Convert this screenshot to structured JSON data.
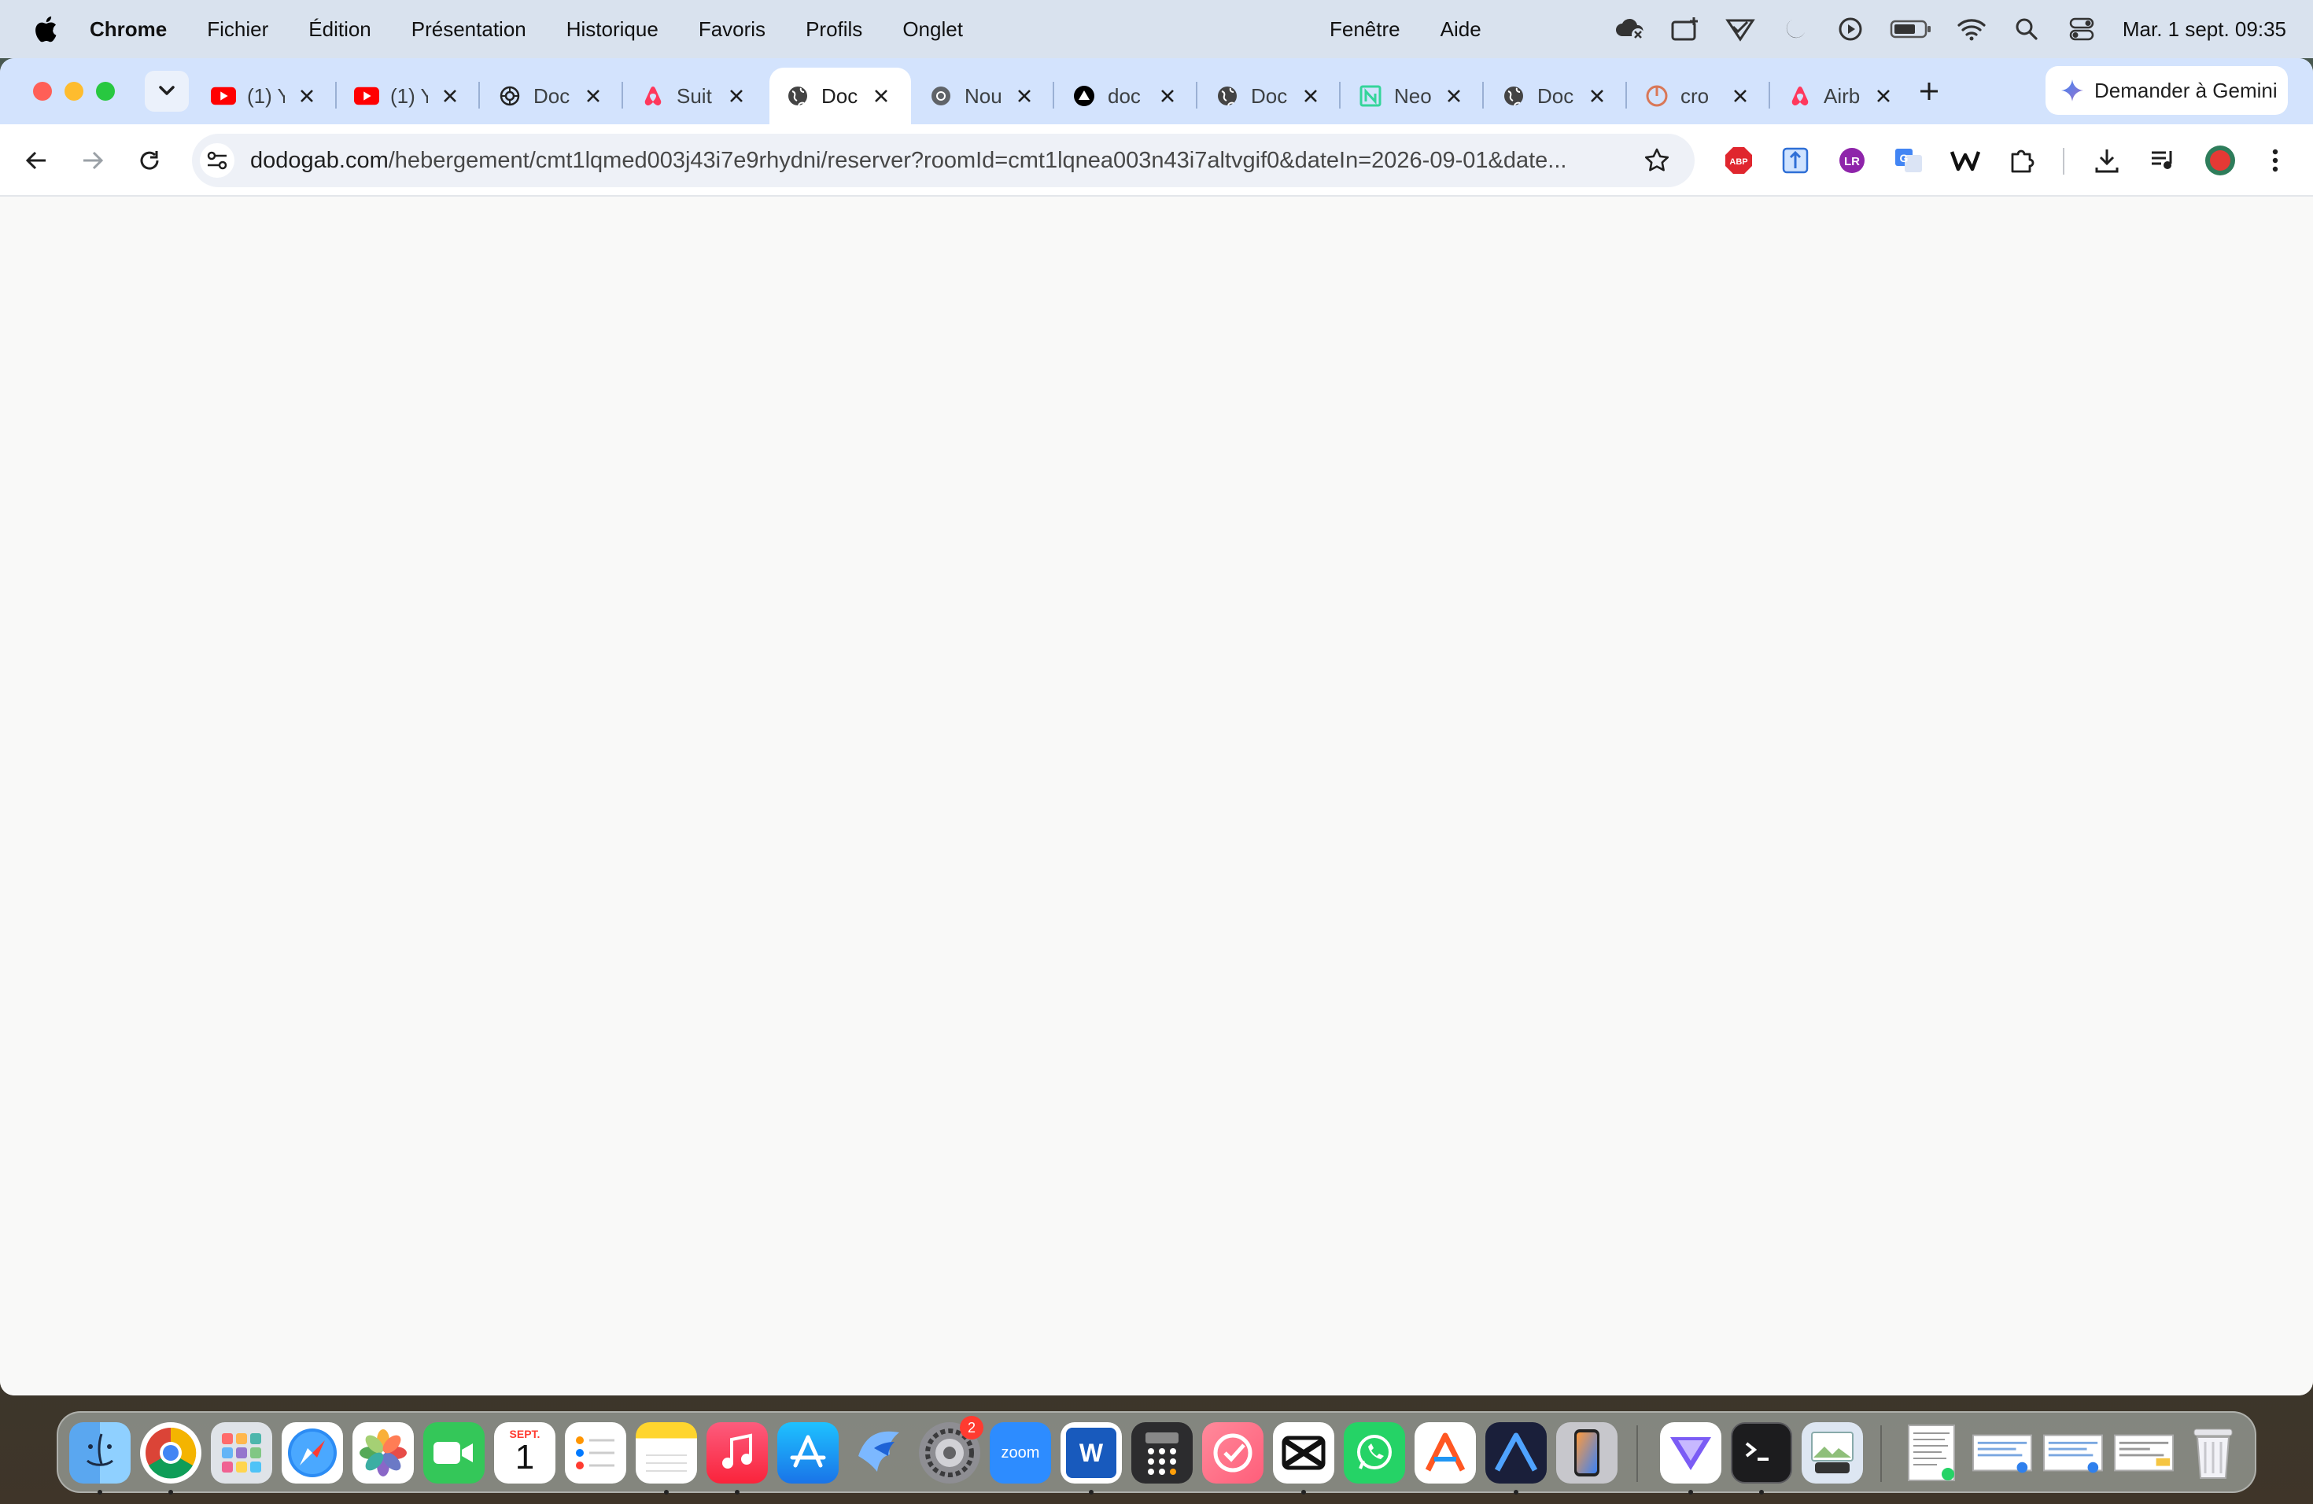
{
  "menubar": {
    "app_name": "Chrome",
    "items": [
      "Fichier",
      "Édition",
      "Présentation",
      "Historique",
      "Favoris",
      "Profils",
      "Onglet"
    ],
    "window_items": [
      "Fenêtre",
      "Aide"
    ],
    "clock": "Mar. 1 sept.  09:35",
    "status_icons": [
      "cloud-off-icon",
      "screen-add-icon",
      "vpn-icon",
      "moon-icon",
      "play-icon",
      "battery-icon",
      "wifi-icon",
      "search-icon",
      "control-center-icon"
    ]
  },
  "tabs": [
    {
      "title": "(1) Y",
      "icon": "youtube-icon",
      "active": false
    },
    {
      "title": "(1) Y",
      "icon": "youtube-icon",
      "active": false
    },
    {
      "title": "Doc",
      "icon": "openai-icon",
      "active": false
    },
    {
      "title": "Suit",
      "icon": "airbnb-icon",
      "active": false
    },
    {
      "title": "Doc",
      "icon": "globe-icon",
      "active": true
    },
    {
      "title": "Nou",
      "icon": "chrome-icon",
      "active": false
    },
    {
      "title": "doc",
      "icon": "vercel-icon",
      "active": false
    },
    {
      "title": "Doc",
      "icon": "globe-icon",
      "active": false
    },
    {
      "title": "Neo",
      "icon": "neon-icon",
      "active": false
    },
    {
      "title": "Doc",
      "icon": "globe-icon",
      "active": false
    },
    {
      "title": "cro",
      "icon": "claude-icon",
      "active": false
    },
    {
      "title": "Airb",
      "icon": "airbnb-icon",
      "active": false
    }
  ],
  "gemini_button": "Demander à Gemini",
  "omnibox": {
    "host": "dodogab.com",
    "path": "/hebergement/cmt1lqmed003j43i7e9rhydni/reserver?roomId=cmt1lqnea003n43i7altvgif0&dateIn=2026-09-01&date..."
  },
  "extensions": [
    "adblock-icon",
    "extension-blue-icon",
    "extension-purple-icon",
    "google-translate-icon",
    "wikiwand-icon",
    "puzzle-icon",
    "download-icon",
    "media-controls-icon",
    "profile-avatar-icon",
    "more-vert-icon"
  ],
  "dock": {
    "apps": [
      "Finder",
      "Chrome",
      "Launchpad",
      "Safari",
      "Photos",
      "FaceTime",
      "Calendar",
      "Reminders",
      "Notes",
      "Music",
      "App Store",
      "Copilot",
      "System Settings",
      "Zoom",
      "Word",
      "Calculator",
      "Checklist",
      "CapCut",
      "WhatsApp",
      "Artstudio",
      "Affinity",
      "iPhone Mirroring",
      "Proton VPN",
      "Terminal",
      "Preview",
      "Downloads",
      "Trash"
    ],
    "calendar_month": "SEPT.",
    "calendar_day": "1",
    "settings_badge": "2",
    "zoom_label": "zoom",
    "word_label": "W"
  }
}
